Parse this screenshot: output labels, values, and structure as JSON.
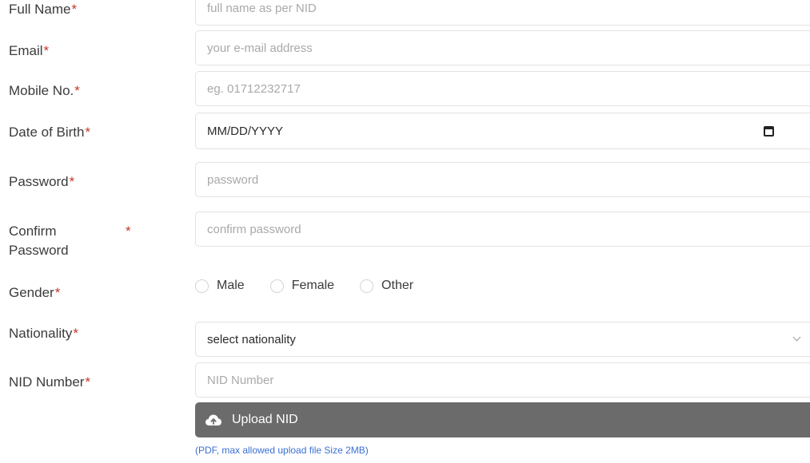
{
  "form": {
    "full_name": {
      "label": "Full Name",
      "required": "*",
      "placeholder": "full name as per NID"
    },
    "email": {
      "label": "Email",
      "required": "*",
      "placeholder": "your e-mail address"
    },
    "mobile": {
      "label": "Mobile No.",
      "required": "*",
      "placeholder": "eg. 01712232717"
    },
    "dob": {
      "label": "Date of Birth",
      "required": "*",
      "value": "MM/DD/YYYY",
      "icon": "calendar-icon"
    },
    "password": {
      "label": "Password",
      "required": "*",
      "placeholder": "password"
    },
    "confirm_password": {
      "label_line1": "Confirm",
      "label_line2": "Password",
      "required": "*",
      "placeholder": "confirm password"
    },
    "gender": {
      "label": "Gender",
      "required": "*",
      "options": [
        "Male",
        "Female",
        "Other"
      ]
    },
    "nationality": {
      "label": "Nationality",
      "required": "*",
      "value": "select nationality",
      "icon": "chevron-down-icon"
    },
    "nid_number": {
      "label": "NID Number",
      "required": "*",
      "placeholder": "NID Number"
    },
    "upload": {
      "label": "Upload NID",
      "icon": "cloud-upload-icon",
      "hint": "(PDF, max allowed upload file Size 2MB)"
    }
  },
  "colors": {
    "required": "#c0392b",
    "upload_bg": "#6b6b6b",
    "hint": "#3b6fd4",
    "border": "#e2e2e2"
  }
}
